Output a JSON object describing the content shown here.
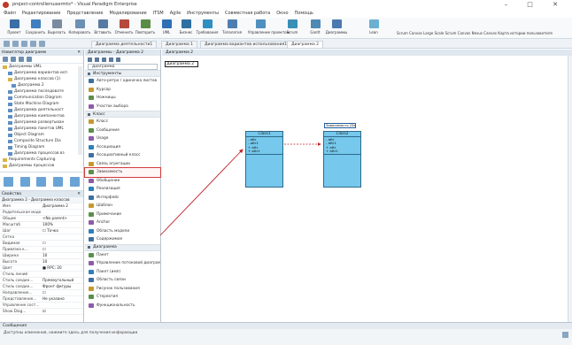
{
  "window": {
    "title": "project-controllersusermts* - Visual Paradigm Enterprise",
    "controls": "– □ ✕"
  },
  "menu": [
    "Файл",
    "Редактирование",
    "Представление",
    "Моделирование",
    "ITSM",
    "Agile",
    "Инструменты",
    "Совместная работа",
    "Окно",
    "Помощь"
  ],
  "toolbar": {
    "items": [
      {
        "label": "Проект",
        "color": "#3a6ea5"
      },
      {
        "label": "Сохранить",
        "color": "#3f7fbf"
      },
      {
        "label": "Вырезать",
        "color": "#7a8aa0"
      },
      {
        "label": "Копировать",
        "color": "#6c8fb4"
      },
      {
        "label": "Вставить",
        "color": "#557aa3"
      },
      {
        "label": "Отменить",
        "color": "#b5493a"
      },
      {
        "label": "Повторить",
        "color": "#5a8c45"
      },
      {
        "label": "UML",
        "color": "#2f6fb3"
      },
      {
        "label": "Бизнес",
        "color": "#2c6fa0"
      },
      {
        "label": "Требования",
        "color": "#2f8fc0"
      },
      {
        "label": "Топология",
        "color": "#4c7fb0"
      },
      {
        "label": "Управление проектом",
        "color": "#4f8fbf"
      },
      {
        "label": "Scrum",
        "color": "#3a8fb7"
      },
      {
        "label": "Gantt",
        "color": "#4f8ab3"
      },
      {
        "label": "Диаграммы",
        "color": "#4a7ab0"
      },
      {
        "label": "Lean",
        "color": "#6ab0d0"
      }
    ],
    "names": "Scrum Canvas   Large Scale Scrum Canvas   Nexus Canvas   Карта истории пользователя"
  },
  "tabs": [
    {
      "label": "Диаграмма деятельности1",
      "active": false
    },
    {
      "label": "Диаграмма 1",
      "active": false
    },
    {
      "label": "Диаграмма вариантов использования1",
      "active": false
    },
    {
      "label": "Диаграмма 2",
      "active": true
    }
  ],
  "explorer": {
    "title": "Навигатор диаграмм",
    "pin": "✕",
    "tree": [
      {
        "label": "Диаграммы UML",
        "blue": false
      },
      {
        "label": "Диаграмма вариантов исп",
        "blue": true
      },
      {
        "label": "Диаграмма классов (1)",
        "blue": false
      },
      {
        "label": "Диаграмма 2",
        "blue": true
      },
      {
        "label": "Диаграмма последовате",
        "blue": true
      },
      {
        "label": "Communication Diagram",
        "blue": true
      },
      {
        "label": "State Machine Diagram",
        "blue": true
      },
      {
        "label": "Диаграмма деятельност",
        "blue": true
      },
      {
        "label": "Диаграмма компонентов",
        "blue": true
      },
      {
        "label": "Диаграмма развертыван",
        "blue": true
      },
      {
        "label": "Диаграмма пакетов UML",
        "blue": true
      },
      {
        "label": "Object Diagram",
        "blue": true
      },
      {
        "label": "Composite Structure Dia",
        "blue": true
      },
      {
        "label": "Timing Diagram",
        "blue": true
      },
      {
        "label": "Диаграмма процессов вз",
        "blue": true
      },
      {
        "label": "Requirements Capturing",
        "blue": false
      },
      {
        "label": "Диаграммы процессов",
        "blue": false
      }
    ]
  },
  "properties": {
    "title": "Свойства",
    "selector": "Диаграмма 2 - Диаграмма классов",
    "rows": [
      {
        "k": "Имя",
        "v": "Диаграмма 2"
      },
      {
        "k": "Родительская модель",
        "v": ""
      },
      {
        "k": "Общие",
        "v": "<No parent>"
      },
      {
        "k": "Масштаб",
        "v": "100%"
      },
      {
        "k": "Шаг",
        "v": "☐ Точка"
      },
      {
        "k": "Сетка",
        "v": ""
      },
      {
        "k": "Видимая",
        "v": "☐"
      },
      {
        "k": "Привязка к…",
        "v": "☐"
      },
      {
        "k": "Ширина",
        "v": "10"
      },
      {
        "k": "Высота",
        "v": "10"
      },
      {
        "k": "Цвет",
        "v": "■ RPC: 20"
      },
      {
        "k": "Стиль линий",
        "v": ""
      },
      {
        "k": "Стиль соедин…",
        "v": "Прямоугольный"
      },
      {
        "k": "Стиль соедин…",
        "v": "Фронт фигуры"
      },
      {
        "k": "Направление…",
        "v": "☐"
      },
      {
        "k": "Представление…",
        "v": "Не указано"
      },
      {
        "k": "Управление сост…",
        "v": ""
      },
      {
        "k": "Show Diag…",
        "v": "☑"
      }
    ]
  },
  "palette": {
    "title": "Диаграммы - Диаграмма 2",
    "search": "Диаграмма",
    "sections": [
      {
        "label": "Инструменты",
        "items": [
          "Авто-ретро / одиночка листов",
          "Курсор",
          "Ножницы",
          "Участок выбора"
        ]
      },
      {
        "label": "Класс",
        "items": [
          "Класс",
          "Сообщение",
          "Usage",
          "Ассоциация",
          "Ассоциативный класс",
          "Связь агрегации",
          "Зависимость",
          "Обобщение",
          "Реализация",
          "Интерфейс",
          "Шаблон",
          "Примечание",
          "Anchor",
          "Область модели",
          "Содержимое"
        ]
      },
      {
        "label": "Диаграмма",
        "items": [
          "Пакет",
          "Управление потоковой диаграммой",
          "Пакет (имп)",
          "Область связи",
          "Рисунок пользования",
          "Стереотип",
          "Функциональность"
        ]
      }
    ],
    "highlighted": "Зависимость"
  },
  "canvas": {
    "breadcrumb": "Диаграмма 2",
    "title": "Диаграмма 2",
    "class_left": {
      "name": "Class1",
      "attrs": [
        "- attr",
        "- attr1",
        "+ attr",
        "+ attr1"
      ]
    },
    "class_right": {
      "name": "Class2",
      "attrs": [
        "- attr",
        "- attr1",
        "+ attr",
        "+ attr1"
      ]
    },
    "tooltip": "Зависимость (Depend)",
    "arrow_color": "#c0202a",
    "class_fill": "#76c8ec"
  },
  "messages": {
    "title": "Сообщения",
    "text": "Доступны изменения, нажмите здесь для получения информации"
  }
}
